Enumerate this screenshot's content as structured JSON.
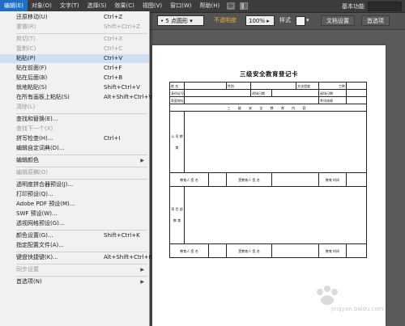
{
  "menubar": {
    "items": [
      "编辑(E)",
      "对象(O)",
      "文字(T)",
      "选择(S)",
      "效果(C)",
      "视图(V)",
      "窗口(W)",
      "帮助(H)"
    ],
    "bridge_label": "Br",
    "workspace_label": "基本功能"
  },
  "controlbar": {
    "brush_value": "5 点圆形",
    "opacity_label": "不透明度",
    "opacity_value": "100%",
    "style_label": "样式",
    "doc_settings_btn": "文档设置",
    "preferences_btn": "首选项"
  },
  "edit_menu": [
    {
      "label": "还原移动(U)",
      "shortcut": "Ctrl+Z",
      "disabled": false
    },
    {
      "label": "重做(R)",
      "shortcut": "Shift+Ctrl+Z",
      "disabled": true
    },
    {
      "sep": true
    },
    {
      "label": "剪切(T)",
      "shortcut": "Ctrl+X",
      "disabled": true
    },
    {
      "label": "复制(C)",
      "shortcut": "Ctrl+C",
      "disabled": true
    },
    {
      "label": "粘贴(P)",
      "shortcut": "Ctrl+V",
      "disabled": false,
      "highlight": true
    },
    {
      "label": "贴在前面(F)",
      "shortcut": "Ctrl+F",
      "disabled": false
    },
    {
      "label": "贴在后面(B)",
      "shortcut": "Ctrl+B",
      "disabled": false
    },
    {
      "label": "就地粘贴(S)",
      "shortcut": "Shift+Ctrl+V",
      "disabled": false
    },
    {
      "label": "在所有画板上粘贴(S)",
      "shortcut": "Alt+Shift+Ctrl+V",
      "disabled": false
    },
    {
      "label": "清除(L)",
      "shortcut": "",
      "disabled": true
    },
    {
      "sep": true
    },
    {
      "label": "查找和替换(E)...",
      "shortcut": "",
      "disabled": false
    },
    {
      "label": "查找下一个(X)",
      "shortcut": "",
      "disabled": true
    },
    {
      "label": "拼写检查(H)...",
      "shortcut": "Ctrl+I",
      "disabled": false
    },
    {
      "label": "编辑自定词典(D)...",
      "shortcut": "",
      "disabled": false
    },
    {
      "sep": true
    },
    {
      "label": "编辑颜色",
      "shortcut": "",
      "disabled": false,
      "submenu": true
    },
    {
      "sep": true
    },
    {
      "label": "编辑原稿(O)",
      "shortcut": "",
      "disabled": true
    },
    {
      "sep": true
    },
    {
      "label": "透明度拼合器预设(J)...",
      "shortcut": "",
      "disabled": false
    },
    {
      "label": "打印预设(Q)...",
      "shortcut": "",
      "disabled": false
    },
    {
      "label": "Adobe PDF 预设(M)...",
      "shortcut": "",
      "disabled": false
    },
    {
      "label": "SWF 预设(W)...",
      "shortcut": "",
      "disabled": false
    },
    {
      "label": "透视网格预设(G)...",
      "shortcut": "",
      "disabled": false
    },
    {
      "sep": true
    },
    {
      "label": "颜色设置(G)...",
      "shortcut": "Shift+Ctrl+K",
      "disabled": false
    },
    {
      "label": "指定配置文件(A)...",
      "shortcut": "",
      "disabled": false
    },
    {
      "sep": true
    },
    {
      "label": "键盘快捷键(K)...",
      "shortcut": "Alt+Shift+Ctrl+K",
      "disabled": false
    },
    {
      "sep": true
    },
    {
      "label": "同步设置",
      "shortcut": "",
      "disabled": true,
      "submenu": true
    },
    {
      "sep": true
    },
    {
      "label": "首选项(N)",
      "shortcut": "",
      "disabled": false,
      "submenu": true
    }
  ],
  "document": {
    "title": "三级安全教育登记卡",
    "row1": {
      "name": "姓 名",
      "gender": "性别",
      "education": "文化程度",
      "job": "工种"
    },
    "row2": {
      "id": "身份证号码",
      "enter_date": "进场日期",
      "leave_date": "退场日期"
    },
    "row3": {
      "address": "家庭地址",
      "exam": "考试成绩"
    },
    "section_header": "三 级 安 全 教 育 内 容",
    "section1_label": "公 司 教 育",
    "section2_label": "项 目 部 教 育",
    "sig": {
      "educator": "教育人 签 名",
      "educatee": "受教育人 签 名",
      "time": "教育 时间"
    }
  },
  "watermark": {
    "text": "jingyan.baidu.com"
  }
}
